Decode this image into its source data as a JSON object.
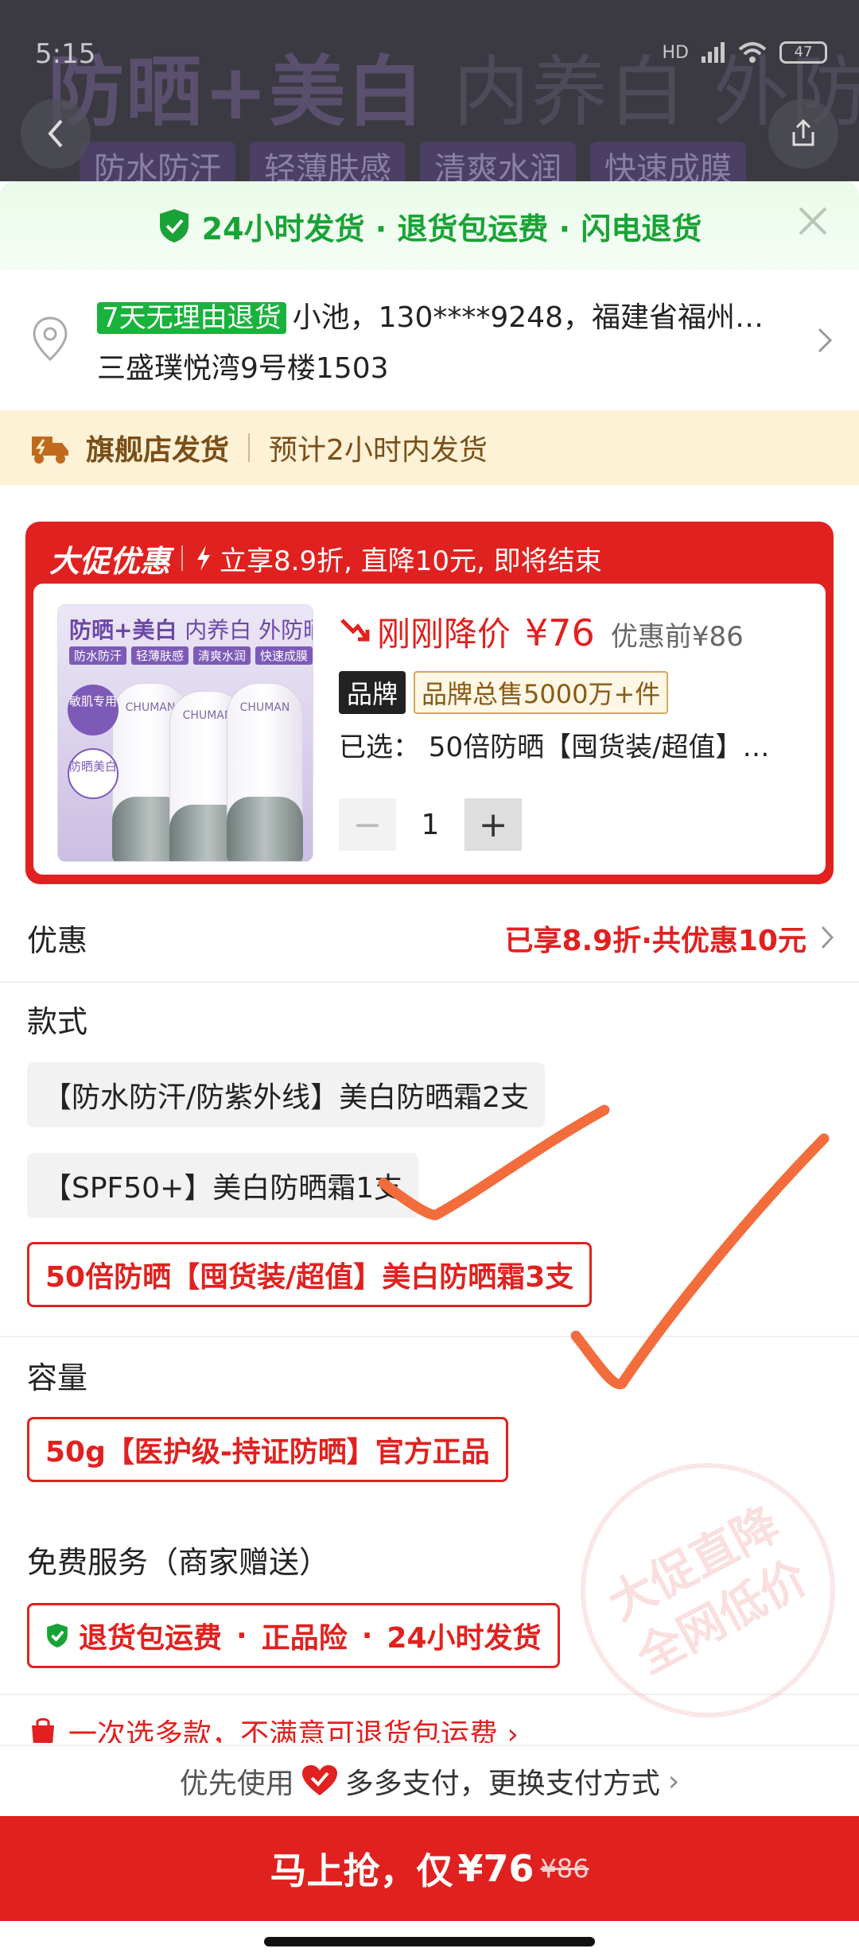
{
  "status_bar": {
    "time": "5:15",
    "network": "HD",
    "battery": "47"
  },
  "banner": {
    "title_bold": "防晒+美白",
    "title_light": "内养白 外防晒",
    "chips": [
      "防水防汗",
      "轻薄肤感",
      "清爽水润",
      "快速成膜"
    ]
  },
  "shipping_strip": {
    "text": "24小时发货 · 退货包运费 · 闪电退货"
  },
  "address": {
    "tag": "7天无理由退货",
    "line1": "小池，130****9248，福建省福州…",
    "line2": "三盛璞悦湾9号楼1503"
  },
  "store_shipping": {
    "title": "旗舰店发货",
    "eta": "预计2小时内发货"
  },
  "promo": {
    "title": "大促优惠",
    "subtitle": "立享8.9折, 直降10元, 即将结束",
    "product_image": {
      "title_bold": "防晒+美白",
      "title_light": "内养白 外防晒",
      "chips": [
        "防水防汗",
        "轻薄肤感",
        "清爽水润",
        "快速成膜"
      ],
      "brand": "CHUMAN",
      "badge1": "敏肌专用",
      "badge2": "防晒美白"
    },
    "price_drop_label": "刚刚降价",
    "price_now": "¥76",
    "price_before": "优惠前¥86",
    "brand_tag": "品牌",
    "brand_sales": "品牌总售5000万+件",
    "selected": "已选：  50倍防晒【囤货装/超值】…",
    "qty": "1",
    "qty_minus": "−",
    "qty_plus": "+"
  },
  "discount": {
    "label": "优惠",
    "value": "已享8.9折·共优惠10元"
  },
  "style_section": {
    "label": "款式",
    "options": [
      "【防水防汗/防紫外线】美白防晒霜2支",
      "【SPF50+】美白防晒霜1支",
      "50倍防晒【囤货装/超值】美白防晒霜3支"
    ]
  },
  "capacity_section": {
    "label": "容量",
    "options": [
      "50g【医护级-持证防晒】官方正品"
    ]
  },
  "services_section": {
    "label": "免费服务（商家赠送）",
    "items": [
      "退货包运费",
      "正品险",
      "24小时发货"
    ],
    "sep": "·"
  },
  "stamp": {
    "line1": "大促直降",
    "line2": "全网低价"
  },
  "multi_tip": {
    "text": "一次选多款，不满意可退货包运费 ›"
  },
  "payment": {
    "prefix": "优先使用",
    "middle": "多多支付，更换支付方式",
    "chevron": "›"
  },
  "buy_button": {
    "label": "马上抢，仅",
    "price": "¥76",
    "original": "¥86"
  },
  "colors": {
    "accent": "#e0211f",
    "green": "#19a336",
    "annotation": "#f36c3c"
  }
}
